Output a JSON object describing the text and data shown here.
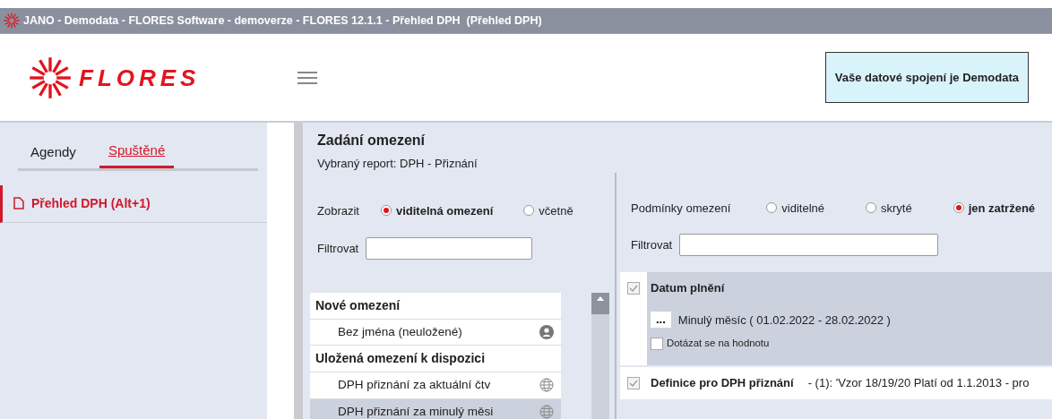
{
  "title_bar": {
    "title": "JANO - Demodata - FLORES Software - demoverze - FLORES 12.1.1 - Přehled DPH  (Přehled DPH)"
  },
  "header": {
    "logo_text": "FLORES",
    "connection_label": "Vaše datové spojení je Demodata"
  },
  "sidebar": {
    "tabs": [
      {
        "label": "Agendy",
        "selected": false
      },
      {
        "label": "Spuštěné",
        "selected": true
      }
    ],
    "items": [
      {
        "label": "Přehled DPH (Alt+1)",
        "selected": true
      }
    ]
  },
  "panel": {
    "title": "Zadání omezení",
    "subtitle": "Vybraný report: DPH - Přiznání"
  },
  "left": {
    "display_label": "Zobrazit",
    "display_options": [
      {
        "label": "viditelná omezení",
        "selected": true
      },
      {
        "label": "včetně",
        "selected": false
      }
    ],
    "filter_label": "Filtrovat",
    "sections": [
      {
        "title": "Nové omezení",
        "items": [
          {
            "label": "Bez jména (neuložené)",
            "kind": "user",
            "selected": false
          }
        ]
      },
      {
        "title": "Uložená omezení k dispozici",
        "items": [
          {
            "label": "DPH přiznání za aktuální čtv",
            "kind": "globe",
            "selected": false
          },
          {
            "label": "DPH přiznání za minulý měsi",
            "kind": "globe",
            "selected": true
          }
        ]
      }
    ]
  },
  "right": {
    "conditions_label": "Podmínky omezení",
    "condition_options": [
      {
        "label": "viditelné",
        "selected": false
      },
      {
        "label": "skryté",
        "selected": false
      },
      {
        "label": "jen zatržené",
        "selected": true
      }
    ],
    "filter_label": "Filtrovat",
    "conditions": [
      {
        "title": "Datum plnění",
        "checked": true,
        "expanded": true,
        "button": "...",
        "value": "Minulý měsíc ( 01.02.2022 - 28.02.2022 )",
        "ask_label": "Dotázat se na hodnotu",
        "ask_checked": false
      },
      {
        "title": "Definice pro DPH přiznání",
        "checked": true,
        "expanded": false,
        "detail": "- (1): 'Vzor 18/19/20 Platí od 1.1.2013 - pro"
      }
    ]
  }
}
